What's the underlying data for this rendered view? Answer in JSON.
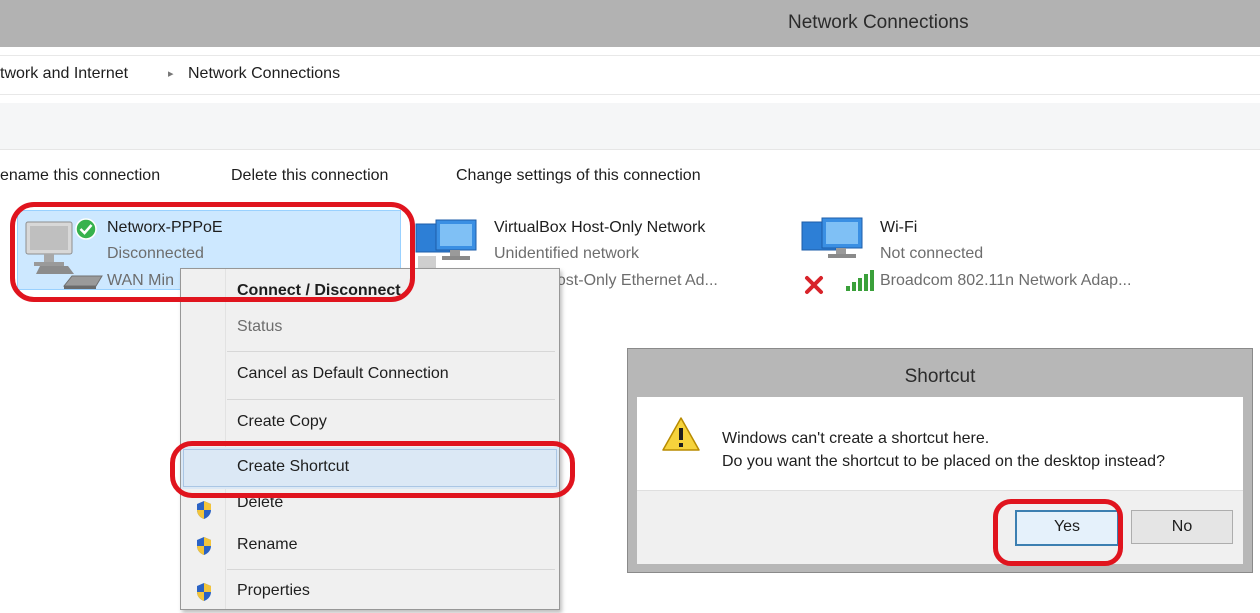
{
  "window": {
    "title": "Network Connections"
  },
  "breadcrumb": {
    "parent": "twork and Internet",
    "current": "Network Connections"
  },
  "commands": {
    "rename": "ename this connection",
    "delete": "Delete this connection",
    "change": "Change settings of this connection"
  },
  "connections": [
    {
      "name": "Networx-PPPoE",
      "status": "Disconnected",
      "adapter": "WAN Min"
    },
    {
      "name": "VirtualBox Host-Only Network",
      "status": "Unidentified network",
      "adapter": "ox Host-Only Ethernet Ad..."
    },
    {
      "name": "Wi-Fi",
      "status": "Not connected",
      "adapter": "Broadcom 802.11n Network Adap..."
    }
  ],
  "context_menu": {
    "items": [
      {
        "label": "Connect / Disconnect"
      },
      {
        "label": "Status"
      },
      {
        "label": "Cancel as Default Connection"
      },
      {
        "label": "Create Copy"
      },
      {
        "label": "Create Shortcut"
      },
      {
        "label": "Delete"
      },
      {
        "label": "Rename"
      },
      {
        "label": "Properties"
      }
    ]
  },
  "dialog": {
    "title": "Shortcut",
    "line1": "Windows can't create a shortcut here.",
    "line2": "Do you want the shortcut to be placed on the desktop instead?",
    "yes_label": "Yes",
    "no_label": "No"
  },
  "colors": {
    "annotation_red": "#e0141e",
    "selection_blue": "#cde8ff",
    "title_gray": "#b2b2b2"
  }
}
